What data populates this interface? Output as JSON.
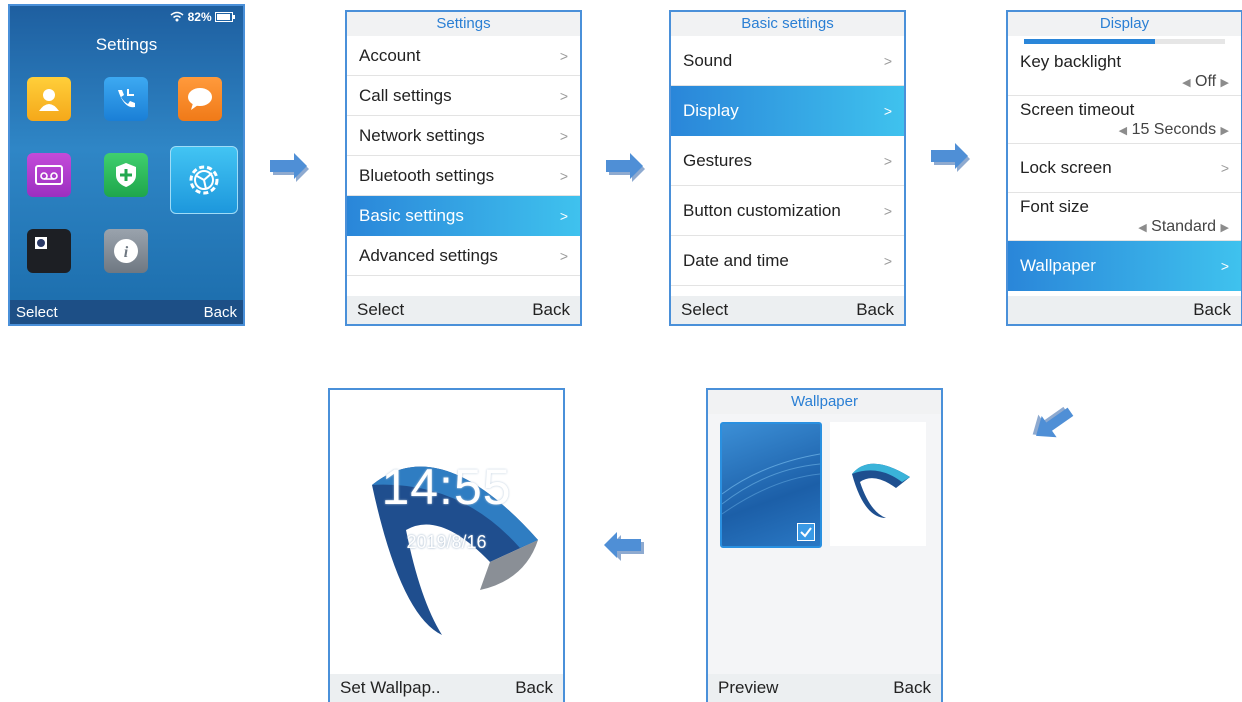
{
  "home": {
    "status": {
      "battery": "82%"
    },
    "title": "Settings",
    "apps": [
      "contacts-icon",
      "call-history-icon",
      "messages-icon",
      "voicemail-icon",
      "security-icon",
      "settings-icon",
      "camera-icon",
      "info-icon"
    ],
    "soft_left": "Select",
    "soft_right": "Back"
  },
  "settings": {
    "title": "Settings",
    "items": [
      {
        "label": "Account"
      },
      {
        "label": "Call settings"
      },
      {
        "label": "Network settings"
      },
      {
        "label": "Bluetooth settings"
      },
      {
        "label": "Basic settings"
      },
      {
        "label": "Advanced settings"
      }
    ],
    "selected_index": 4,
    "soft_left": "Select",
    "soft_right": "Back"
  },
  "basic": {
    "title": "Basic settings",
    "items": [
      {
        "label": "Sound"
      },
      {
        "label": "Display"
      },
      {
        "label": "Gestures"
      },
      {
        "label": "Button customization"
      },
      {
        "label": "Date and time"
      }
    ],
    "selected_index": 1,
    "soft_left": "Select",
    "soft_right": "Back"
  },
  "display": {
    "title": "Display",
    "scroll_fraction": 0.65,
    "items": [
      {
        "label": "Key backlight",
        "value": "Off"
      },
      {
        "label": "Screen timeout",
        "value": "15 Seconds"
      },
      {
        "label": "Lock screen"
      },
      {
        "label": "Font size",
        "value": "Standard"
      },
      {
        "label": "Wallpaper"
      }
    ],
    "soft_right": "Back"
  },
  "wallpaper": {
    "title": "Wallpaper",
    "soft_left": "Preview",
    "soft_right": "Back"
  },
  "preview": {
    "time": "14:55",
    "date": "2019/8/16",
    "soft_left": "Set Wallpap..",
    "soft_right": "Back"
  },
  "colors": {
    "accent": "#2a7fd4",
    "selected_start": "#2a86d9",
    "selected_end": "#3fc2ee",
    "arrow": "#4f8fd6"
  }
}
